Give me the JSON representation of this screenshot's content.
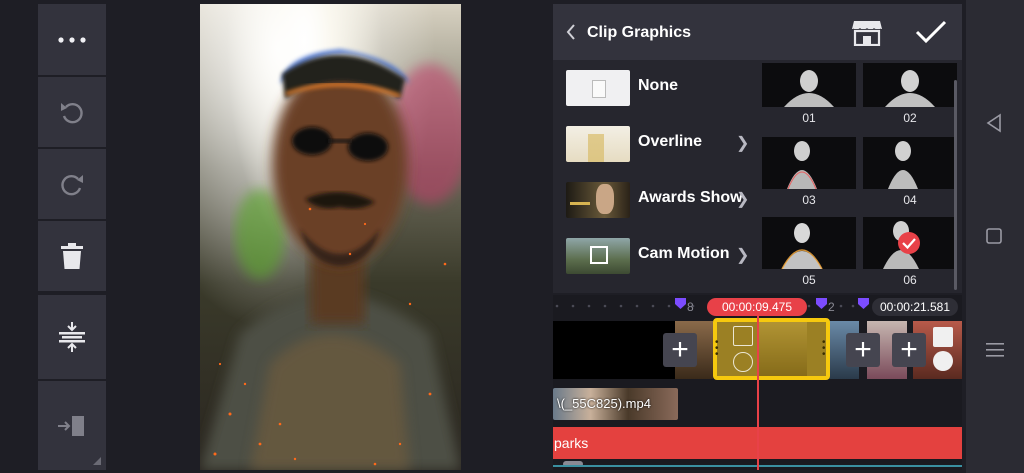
{
  "toolbar": {
    "more_icon": "more-horizontal-icon",
    "undo_icon": "undo-icon",
    "redo_icon": "redo-icon",
    "delete_icon": "trash-icon",
    "layers_icon": "split-layers-icon",
    "export_icon": "arrow-into-panel-icon"
  },
  "panel": {
    "title": "Clip Graphics",
    "categories": [
      {
        "label": "None"
      },
      {
        "label": "Overline"
      },
      {
        "label": "Awards Show"
      },
      {
        "label": "Cam Motion"
      }
    ],
    "grid": [
      {
        "label": "01"
      },
      {
        "label": "02"
      },
      {
        "label": "03"
      },
      {
        "label": "04"
      },
      {
        "label": "05"
      },
      {
        "label": "06",
        "selected": true
      }
    ]
  },
  "timeline": {
    "ruler_left_marker": "8",
    "ruler_right_marker": "2",
    "current_time": "00:00:09.475",
    "total_time": "00:00:21.581",
    "clip_filename": "\\(_55C825).mp4",
    "effect_layer_label": "parks"
  },
  "colors": {
    "accent_red": "#e84148",
    "clip_selected": "#f6c90e",
    "marker_purple": "#7c4cff"
  }
}
